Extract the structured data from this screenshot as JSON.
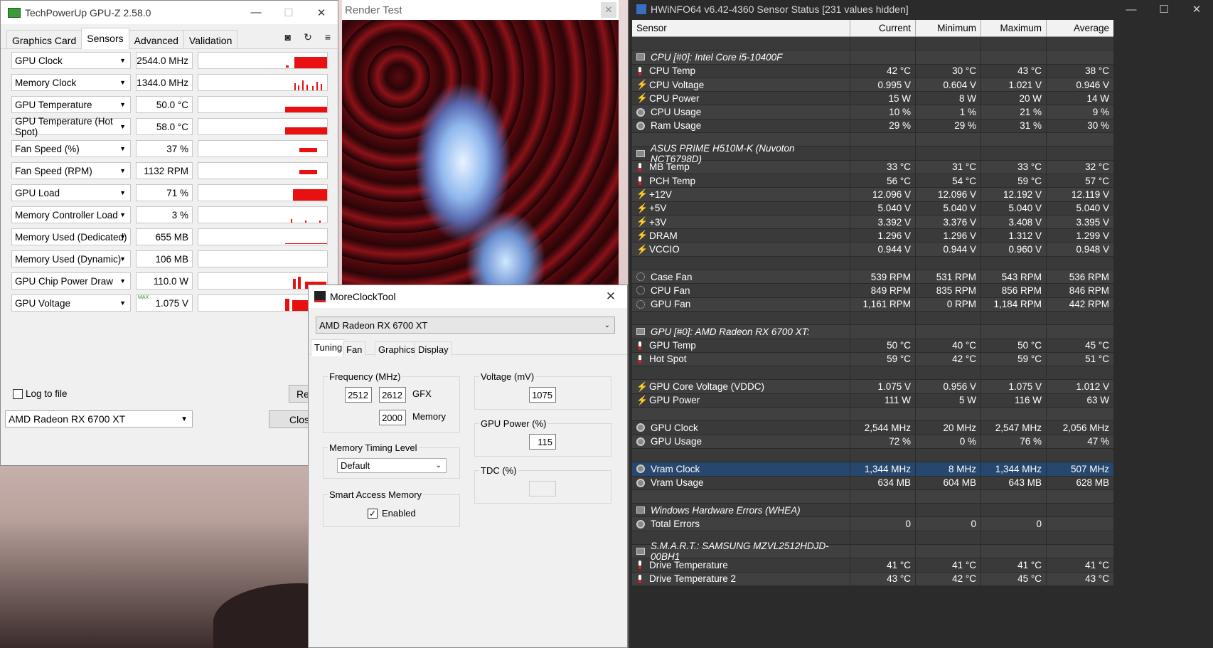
{
  "gpuz": {
    "title": "TechPowerUp GPU-Z 2.58.0",
    "tabs": [
      "Graphics Card",
      "Sensors",
      "Advanced",
      "Validation"
    ],
    "active_tab": "Sensors",
    "sensors": [
      {
        "name": "GPU Clock",
        "value": "2544.0 MHz"
      },
      {
        "name": "Memory Clock",
        "value": "1344.0 MHz"
      },
      {
        "name": "GPU Temperature",
        "value": "50.0 °C"
      },
      {
        "name": "GPU Temperature (Hot Spot)",
        "value": "58.0 °C"
      },
      {
        "name": "Fan Speed (%)",
        "value": "37 %"
      },
      {
        "name": "Fan Speed (RPM)",
        "value": "1132 RPM"
      },
      {
        "name": "GPU Load",
        "value": "71 %"
      },
      {
        "name": "Memory Controller Load",
        "value": "3 %"
      },
      {
        "name": "Memory Used (Dedicated)",
        "value": "655 MB"
      },
      {
        "name": "Memory Used (Dynamic)",
        "value": "106 MB"
      },
      {
        "name": "GPU Chip Power Draw",
        "value": "110.0 W"
      },
      {
        "name": "GPU Voltage",
        "value": "1.075 V",
        "tag": "MAX"
      }
    ],
    "log_to_file": "Log to file",
    "reset_button": "Re",
    "close_button": "Clos",
    "gpu_select": "AMD Radeon RX 6700 XT"
  },
  "render": {
    "title": "Render Test",
    "close": "✕"
  },
  "mct": {
    "title": "MoreClockTool",
    "gpu_select": "AMD Radeon RX 6700 XT",
    "tabs": [
      "Tuning",
      "Fan",
      "Graphics",
      "Display"
    ],
    "frequency": {
      "legend": "Frequency (MHz)",
      "min": "2512",
      "max": "2612",
      "gfx_label": "GFX",
      "memory": "2000",
      "memory_label": "Memory"
    },
    "voltage": {
      "legend": "Voltage (mV)",
      "value": "1075"
    },
    "gpu_power": {
      "legend": "GPU Power (%)",
      "value": "115"
    },
    "tdc": {
      "legend": "TDC (%)",
      "value": ""
    },
    "mem_timing": {
      "legend": "Memory Timing Level",
      "value": "Default"
    },
    "sam": {
      "legend": "Smart Access Memory",
      "label": "Enabled"
    }
  },
  "hwinfo": {
    "title": "HWiNFO64 v6.42-4360 Sensor Status [231 values hidden]",
    "columns": [
      "Sensor",
      "Current",
      "Minimum",
      "Maximum",
      "Average"
    ],
    "rows": [
      {
        "type": "blank"
      },
      {
        "type": "group",
        "name": "CPU [#0]: Intel Core i5-10400F"
      },
      {
        "type": "temp",
        "name": "CPU Temp",
        "v": [
          "42 °C",
          "30 °C",
          "43 °C",
          "38 °C"
        ]
      },
      {
        "type": "volt",
        "name": "CPU Voltage",
        "v": [
          "0.995 V",
          "0.604 V",
          "1.021 V",
          "0.946 V"
        ]
      },
      {
        "type": "volt",
        "name": "CPU Power",
        "v": [
          "15 W",
          "8 W",
          "20 W",
          "14 W"
        ]
      },
      {
        "type": "usage",
        "name": "CPU Usage",
        "v": [
          "10 %",
          "1 %",
          "21 %",
          "9 %"
        ]
      },
      {
        "type": "usage",
        "name": "Ram Usage",
        "v": [
          "29 %",
          "29 %",
          "31 %",
          "30 %"
        ]
      },
      {
        "type": "blank"
      },
      {
        "type": "group",
        "name": "ASUS PRIME H510M-K (Nuvoton NCT6798D)"
      },
      {
        "type": "temp",
        "name": "MB Temp",
        "v": [
          "33 °C",
          "31 °C",
          "33 °C",
          "32 °C"
        ]
      },
      {
        "type": "temp",
        "name": "PCH Temp",
        "v": [
          "56 °C",
          "54 °C",
          "59 °C",
          "57 °C"
        ]
      },
      {
        "type": "volt",
        "name": "+12V",
        "v": [
          "12.096 V",
          "12.096 V",
          "12.192 V",
          "12.119 V"
        ]
      },
      {
        "type": "volt",
        "name": "+5V",
        "v": [
          "5.040 V",
          "5.040 V",
          "5.040 V",
          "5.040 V"
        ]
      },
      {
        "type": "volt",
        "name": "+3V",
        "v": [
          "3.392 V",
          "3.376 V",
          "3.408 V",
          "3.395 V"
        ]
      },
      {
        "type": "volt",
        "name": "DRAM",
        "v": [
          "1.296 V",
          "1.296 V",
          "1.312 V",
          "1.299 V"
        ]
      },
      {
        "type": "volt",
        "name": "VCCIO",
        "v": [
          "0.944 V",
          "0.944 V",
          "0.960 V",
          "0.948 V"
        ]
      },
      {
        "type": "blank"
      },
      {
        "type": "fan",
        "name": "Case Fan",
        "v": [
          "539 RPM",
          "531 RPM",
          "543 RPM",
          "536 RPM"
        ]
      },
      {
        "type": "fan",
        "name": "CPU Fan",
        "v": [
          "849 RPM",
          "835 RPM",
          "856 RPM",
          "846 RPM"
        ]
      },
      {
        "type": "fan",
        "name": "GPU Fan",
        "v": [
          "1,161 RPM",
          "0 RPM",
          "1,184 RPM",
          "442 RPM"
        ]
      },
      {
        "type": "blank"
      },
      {
        "type": "group",
        "name": "GPU [#0]: AMD Radeon RX 6700 XT:"
      },
      {
        "type": "temp",
        "name": "GPU Temp",
        "v": [
          "50 °C",
          "40 °C",
          "50 °C",
          "45 °C"
        ]
      },
      {
        "type": "temp",
        "name": "Hot Spot",
        "v": [
          "59 °C",
          "42 °C",
          "59 °C",
          "51 °C"
        ]
      },
      {
        "type": "blank"
      },
      {
        "type": "volt",
        "name": "GPU Core Voltage (VDDC)",
        "v": [
          "1.075 V",
          "0.956 V",
          "1.075 V",
          "1.012 V"
        ]
      },
      {
        "type": "volt",
        "name": "GPU Power",
        "v": [
          "111 W",
          "5 W",
          "116 W",
          "63 W"
        ]
      },
      {
        "type": "blank"
      },
      {
        "type": "usage",
        "name": "GPU Clock",
        "v": [
          "2,544 MHz",
          "20 MHz",
          "2,547 MHz",
          "2,056 MHz"
        ]
      },
      {
        "type": "usage",
        "name": "GPU Usage",
        "v": [
          "72 %",
          "0 %",
          "76 %",
          "47 %"
        ]
      },
      {
        "type": "blank"
      },
      {
        "type": "usage",
        "name": "Vram Clock",
        "v": [
          "1,344 MHz",
          "8 MHz",
          "1,344 MHz",
          "507 MHz"
        ],
        "selected": true
      },
      {
        "type": "usage",
        "name": "Vram Usage",
        "v": [
          "634 MB",
          "604 MB",
          "643 MB",
          "628 MB"
        ]
      },
      {
        "type": "blank"
      },
      {
        "type": "group",
        "name": "Windows Hardware Errors (WHEA)"
      },
      {
        "type": "usage",
        "name": "Total Errors",
        "v": [
          "0",
          "0",
          "0",
          ""
        ]
      },
      {
        "type": "blank"
      },
      {
        "type": "group",
        "name": "S.M.A.R.T.: SAMSUNG MZVL2512HDJD-00BH1"
      },
      {
        "type": "temp",
        "name": "Drive Temperature",
        "v": [
          "41 °C",
          "41 °C",
          "41 °C",
          "41 °C"
        ]
      },
      {
        "type": "temp",
        "name": "Drive Temperature 2",
        "v": [
          "43 °C",
          "42 °C",
          "45 °C",
          "43 °C"
        ]
      }
    ]
  },
  "colors": {
    "graph_red": "#e81010",
    "hw_bg": "#2b2b2b",
    "hw_selected": "#26476e"
  }
}
